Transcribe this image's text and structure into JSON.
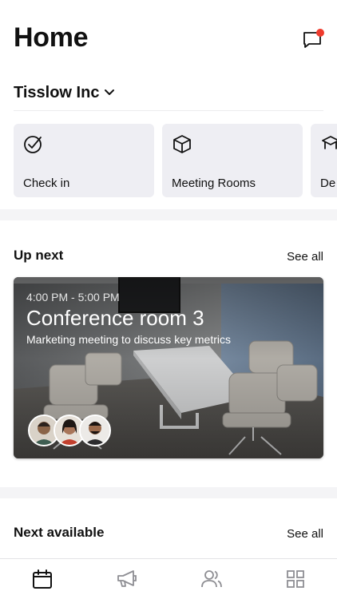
{
  "header": {
    "title": "Home",
    "message_icon": "chat-bubble-icon",
    "notification_color": "#ef3b2d"
  },
  "org": {
    "name": "Tisslow Inc",
    "icon": "chevron-down-icon"
  },
  "quick_actions": [
    {
      "label": "Check in",
      "icon": "check-circle-icon"
    },
    {
      "label": "Meeting Rooms",
      "icon": "cube-icon"
    },
    {
      "label": "De",
      "icon": "desk-icon"
    }
  ],
  "up_next": {
    "title": "Up next",
    "see_all": "See all",
    "event": {
      "time": "4:00 PM - 5:00 PM",
      "room": "Conference room 3",
      "description": "Marketing meeting to discuss key metrics",
      "attendees": [
        "attendee-1",
        "attendee-2",
        "attendee-3"
      ]
    }
  },
  "next_available": {
    "title": "Next available",
    "see_all": "See all"
  },
  "tabbar": {
    "items": [
      "calendar-icon",
      "megaphone-icon",
      "people-icon",
      "grid-icon"
    ],
    "active": "calendar-icon"
  }
}
